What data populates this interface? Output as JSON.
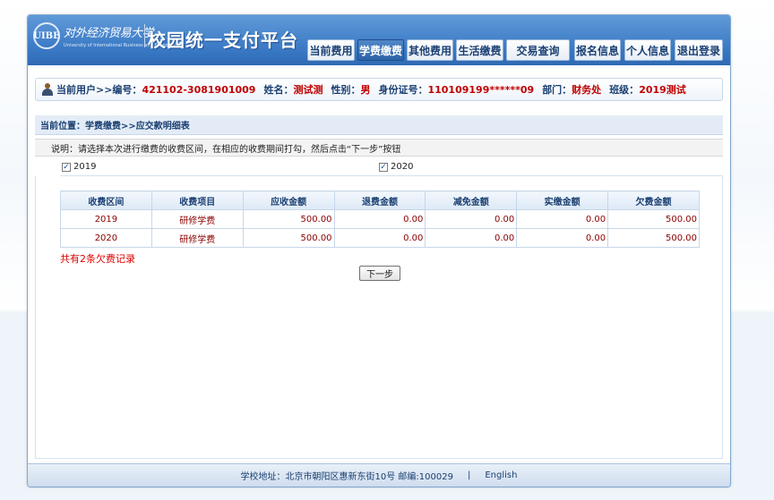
{
  "header": {
    "logo_emblem": "UIBE",
    "logo_script": "对外经济贸易大学",
    "logo_sub": "University of International Business and Economics",
    "site_title": "校园统一支付平台"
  },
  "nav": [
    {
      "label": "当前费用",
      "active": false
    },
    {
      "label": "学费缴费",
      "active": true
    },
    {
      "label": "其他费用",
      "active": false
    },
    {
      "label": "生活缴费",
      "active": false
    },
    {
      "label": "交易查询",
      "active": false
    },
    {
      "label": "报名信息",
      "active": false
    },
    {
      "label": "个人信息",
      "active": false
    },
    {
      "label": "退出登录",
      "active": false
    }
  ],
  "user": {
    "current_user_label": "当前用户>>编号：",
    "id": "421102-3081901009",
    "name_label": "姓名：",
    "name": "测试测",
    "gender_label": "性别：",
    "gender": "男",
    "idcard_label": "身份证号：",
    "idcard": "110109199******09",
    "dept_label": "部门：",
    "dept": "财务处",
    "class_label": "班级：",
    "class": "2019测试"
  },
  "location": "当前位置：学费缴费>>应交款明细表",
  "note": "说明：请选择本次进行缴费的收费区间，在相应的收费期间打勾，然后点击“下一步”按钮",
  "periods": [
    {
      "label": "2019",
      "checked": true,
      "mark": "✓"
    },
    {
      "label": "2020",
      "checked": true,
      "mark": "✓"
    }
  ],
  "table": {
    "headers": [
      "收费区间",
      "收费项目",
      "应收金额",
      "退费金额",
      "减免金额",
      "实缴金额",
      "欠费金额"
    ],
    "rows": [
      [
        "2019",
        "研修学费",
        "500.00",
        "0.00",
        "0.00",
        "0.00",
        "500.00"
      ],
      [
        "2020",
        "研修学费",
        "500.00",
        "0.00",
        "0.00",
        "0.00",
        "500.00"
      ]
    ]
  },
  "summary": "共有2条欠费记录",
  "next_button": "下一步",
  "footer": {
    "address": "学校地址：北京市朝阳区惠新东街10号 邮编:100029",
    "separator": "|",
    "english_link": "English"
  }
}
